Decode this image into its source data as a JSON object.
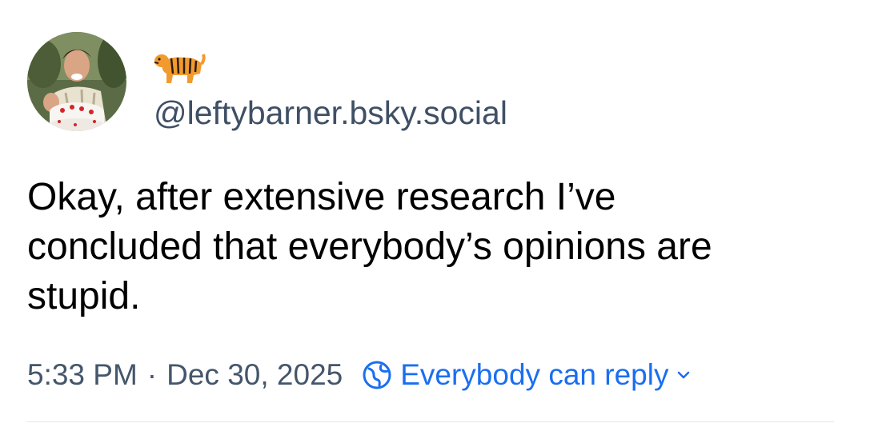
{
  "post": {
    "display_name_emoji": "tiger-emoji",
    "handle": "@leftybarner.bsky.social",
    "text": "Okay, after extensive research I’ve\nconcluded that everybody’s opinions are\nstupid.",
    "time": "5:33 PM",
    "separator": "·",
    "date": "Dec 30, 2025",
    "reply_setting": "Everybody can reply"
  },
  "icons": {
    "avatar": "profile-photo-man-with-cake",
    "reply_globe": "globe-icon",
    "reply_chevron": "chevron-down-icon"
  },
  "colors": {
    "text": "#000000",
    "secondary": "#44566b",
    "accent": "#1a6ef0",
    "divider": "#e3e6ea"
  }
}
